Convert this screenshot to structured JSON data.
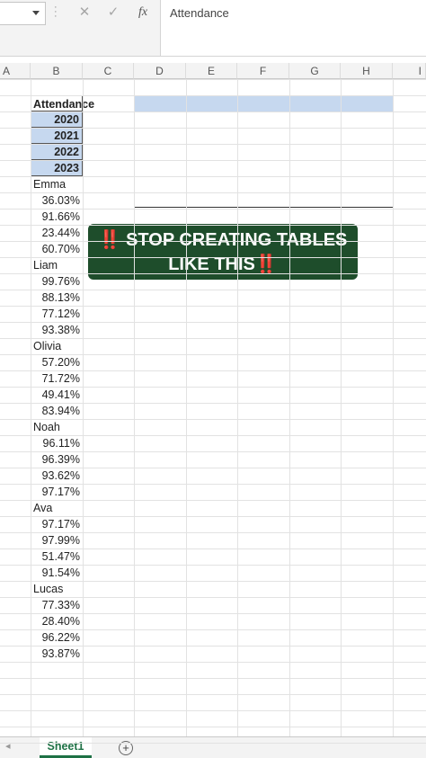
{
  "formula_bar": {
    "cancel_icon": "✕",
    "enter_icon": "✓",
    "fx_icon": "fx",
    "value": "Attendance"
  },
  "columns": [
    "A",
    "B",
    "C",
    "D",
    "E",
    "F",
    "G",
    "H",
    "I"
  ],
  "column_b": {
    "header": "Attendance",
    "years": [
      "2020",
      "2021",
      "2022",
      "2023"
    ],
    "rows": [
      "Emma",
      "36.03%",
      "91.66%",
      "23.44%",
      "60.70%",
      "Liam",
      "99.76%",
      "88.13%",
      "77.12%",
      "93.38%",
      "Olivia",
      "57.20%",
      "71.72%",
      "49.41%",
      "83.94%",
      "Noah",
      "96.11%",
      "96.39%",
      "93.62%",
      "97.17%",
      "Ava",
      "97.17%",
      "97.99%",
      "51.47%",
      "91.54%",
      "Lucas",
      "77.33%",
      "28.40%",
      "96.22%",
      "93.87%"
    ]
  },
  "banner": {
    "emoji": "‼️",
    "line1": "STOP CREATING TABLES",
    "line2": "LIKE THIS"
  },
  "sheet_tabs": {
    "active": "Sheet1",
    "add_icon": "+"
  },
  "colors": {
    "header_fill": "#c6d8ef",
    "banner_bg": "#1e4d2b",
    "accent": "#1e7145"
  }
}
